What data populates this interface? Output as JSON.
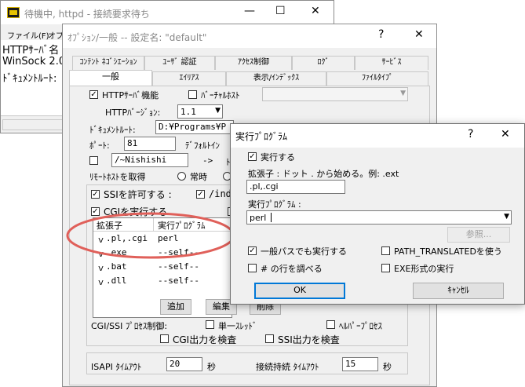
{
  "back_window": {
    "title": "待機中, httpd - 接続要求待ち",
    "menu": [
      "ファイル(F)",
      "オプ"
    ],
    "log_lines": [
      "HTTPｻｰﾊﾞ名",
      "WinSock 2.0",
      "ﾄﾞｷｭﾒﾝﾄﾙｰﾄ:"
    ]
  },
  "options_window": {
    "title": "ｵﾌﾟｼｮﾝ/一般 -- 設定名: \"default\"",
    "tabs_row1": [
      "ｺﾝﾃﾝﾄ ﾈｺﾞｼｴｰｼｮﾝ",
      "ﾕｰｻﾞ 認証",
      "ｱｸｾｽ制御",
      "ﾛｸﾞ",
      "ｻｰﾋﾞｽ"
    ],
    "tabs_row2": [
      "一般",
      "ｴｲﾘｱｽ",
      "表示/ｲﾝﾃﾞｯｸｽ",
      "ﾌｧｲﾙﾀｲﾌﾟ"
    ],
    "http_server_label": "HTTPｻｰﾊﾞ機能",
    "virtual_host_label": "ﾊﾞｰﾁｬﾙﾎｽﾄ",
    "http_version_label": "HTTPﾊﾞｰｼﾞｮﾝ:",
    "http_version_value": "1.1",
    "docroot_label": "ﾄﾞｷｭﾒﾝﾄﾙｰﾄ:",
    "docroot_value": "D:¥Programs¥P",
    "port_label": "ﾎﾟｰﾄ:",
    "port_value": "81",
    "default_label": "ﾃﾞﾌｫﾙﾄｲﾝ",
    "alias_value": "/~Nishishi",
    "arrow_text": "->",
    "alias_trail": "ﾄ",
    "remote_host_label": "ﾘﾓｰﾄﾎｽﾄを取得",
    "always_label": "常時",
    "ssi_label": "SSIを許可する :",
    "ssi_path": "/ind",
    "cgi_label": "CGIを実行する",
    "ext_headers": [
      "拡張子",
      "実行ﾌﾟﾛｸﾞﾗﾑ"
    ],
    "ext_rows": [
      {
        "ext": ".pl,.cgi",
        "prog": "perl"
      },
      {
        "ext": ".exe",
        "prog": "--self--"
      },
      {
        "ext": ".bat",
        "prog": "--self--"
      },
      {
        "ext": ".dll",
        "prog": "--self--"
      }
    ],
    "add_btn": "追加",
    "edit_btn": "編集",
    "delete_btn": "削除",
    "process_label": "CGI/SSI ﾌﾟﾛｾｽ制御:",
    "single_thread_label": "単一ｽﾚｯﾄﾞ",
    "helper_label": "ﾍﾙﾊﾟｰﾌﾟﾛｾｽ",
    "check_cgi_output": "CGI出力を検査",
    "check_ssi_output": "SSI出力を検査",
    "isapi_label": "ISAPI ﾀｲﾑｱｳﾄ",
    "isapi_value": "20",
    "sec1": "秒",
    "keepalive_label": "接続持続 ﾀｲﾑｱｳﾄ",
    "keepalive_value": "15",
    "sec2": "秒",
    "help": "?",
    "close": "✕"
  },
  "exec_dialog": {
    "title": "実行ﾌﾟﾛｸﾞﾗﾑ",
    "help": "?",
    "close": "✕",
    "execute_label": "実行する",
    "ext_desc": "拡張子 : ドット . から始める。例: .ext",
    "ext_value": ".pl,.cgi",
    "prog_label": "実行ﾌﾟﾛｸﾞﾗﾑ :",
    "prog_value": "perl",
    "browse_btn": "参照...",
    "general_path_label": "一般パスでも実行する",
    "path_translated_label": "PATH_TRANSLATEDを使う",
    "hash_line_label": "# の行を調べる",
    "exe_format_label": "EXE形式の実行",
    "ok_btn": "OK",
    "cancel_btn": "ｷｬﾝｾﾙ"
  },
  "colors": {
    "annotation": "#e0605a",
    "focus": "#0078d7"
  }
}
